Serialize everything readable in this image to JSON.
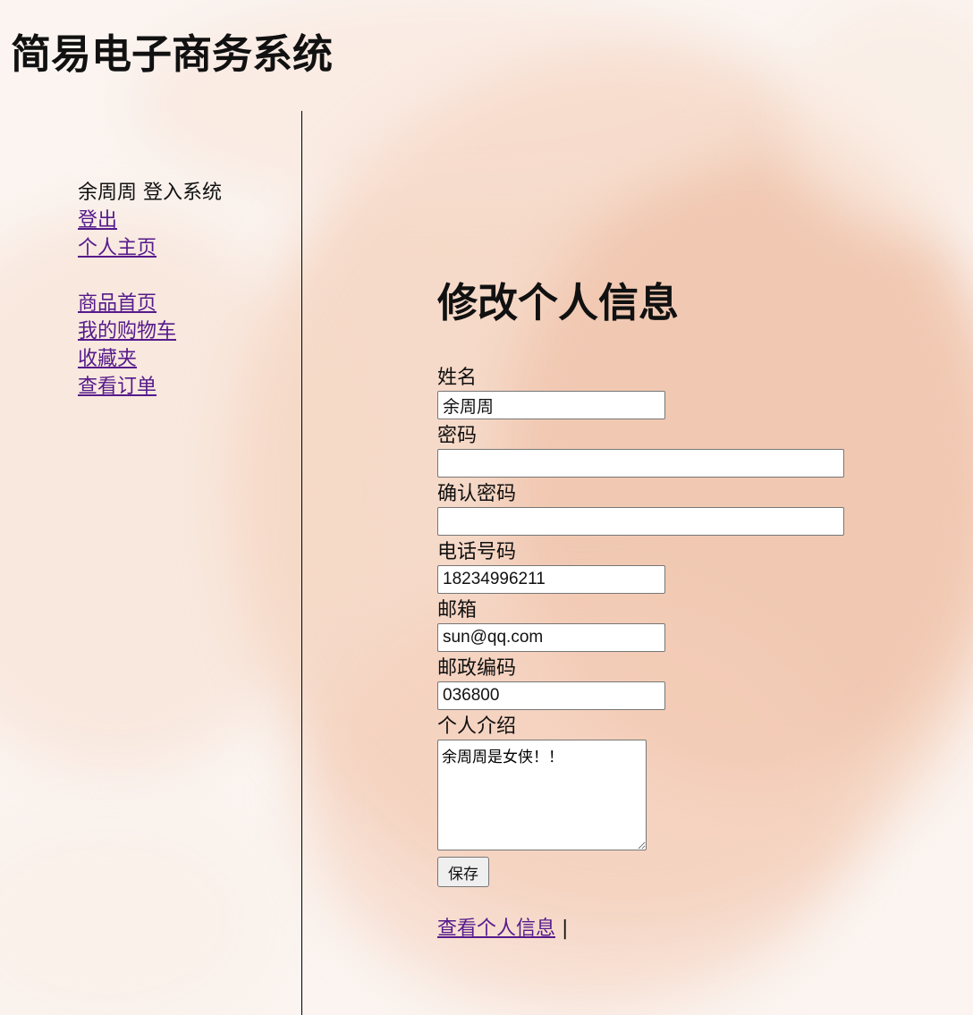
{
  "header": {
    "title": "简易电子商务系统"
  },
  "sidebar": {
    "user_status": "余周周 登入系统",
    "links_top": [
      {
        "label": "登出"
      },
      {
        "label": "个人主页"
      }
    ],
    "links_main": [
      {
        "label": "商品首页"
      },
      {
        "label": "我的购物车"
      },
      {
        "label": "收藏夹"
      },
      {
        "label": "查看订单"
      }
    ]
  },
  "form": {
    "title": "修改个人信息",
    "fields": {
      "name": {
        "label": "姓名",
        "value": "余周周"
      },
      "password": {
        "label": "密码",
        "value": ""
      },
      "confirm_password": {
        "label": "确认密码",
        "value": ""
      },
      "phone": {
        "label": "电话号码",
        "value": "18234996211"
      },
      "email": {
        "label": "邮箱",
        "value": "sun@qq.com"
      },
      "postal_code": {
        "label": "邮政编码",
        "value": "036800"
      },
      "bio": {
        "label": "个人介绍",
        "value": "余周周是女侠！！"
      }
    },
    "save_label": "保存"
  },
  "footer": {
    "view_profile_link": "查看个人信息",
    "separator": "|"
  }
}
